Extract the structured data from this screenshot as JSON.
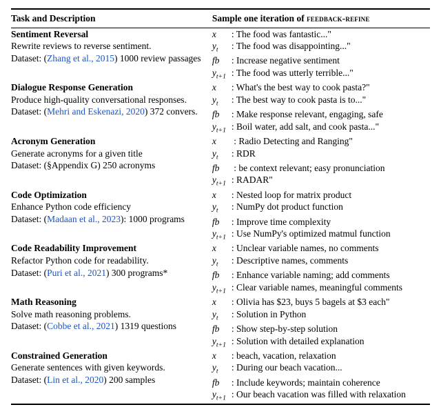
{
  "header": {
    "left": "Task and Description",
    "right_prefix": "Sample one iteration of ",
    "right_method": "feedback-refine"
  },
  "rows": [
    {
      "title": "Sentiment Reversal",
      "desc": "Rewrite reviews to reverse sentiment.",
      "ds_prefix": "Dataset: (",
      "ds_cite": "Zhang et al., 2015",
      "ds_suffix": ") 1000 review passages",
      "x": "The food was fantastic...\"",
      "yt": "The food was disappointing...\"",
      "fb": "Increase negative sentiment",
      "yt1": "The food was utterly terrible...\""
    },
    {
      "title": "Dialogue Response Generation",
      "desc": "Produce high-quality conversational responses.",
      "ds_prefix": "Dataset: (",
      "ds_cite": "Mehri and Eskenazi, 2020",
      "ds_suffix": ") 372 convers.",
      "x": "What's the best way to cook pasta?\"",
      "yt": "The best way to cook pasta is to...\"",
      "fb": "Make response relevant, engaging, safe",
      "yt1": "Boil water, add salt, and cook pasta...\""
    },
    {
      "title": "Acronym Generation",
      "desc": "Generate acronyms for a given title",
      "ds_prefix": "Dataset: (",
      "ds_cite": "§Appendix G",
      "ds_cite_plain": true,
      "ds_suffix": ") 250 acronyms",
      "x": "Radio Detecting and Ranging\"",
      "x_extra_colon": true,
      "yt": "RDR",
      "fb": "be context relevant; easy pronunciation",
      "fb_extra_colon": true,
      "yt1": "RADAR\""
    },
    {
      "title": "Code Optimization",
      "desc": "Enhance Python code efficiency",
      "ds_prefix": "Dataset: (",
      "ds_cite": "Madaan et al., 2023",
      "ds_suffix": "): 1000 programs",
      "x": "Nested loop for matrix product",
      "yt": "NumPy dot product function",
      "fb": "Improve time complexity",
      "yt1": "Use NumPy's optimized matmul function"
    },
    {
      "title": "Code Readability Improvement",
      "desc": "Refactor Python code for readability.",
      "ds_prefix": "Dataset: (",
      "ds_cite": "Puri et al., 2021",
      "ds_suffix": ") 300 programs*",
      "x": "Unclear variable names, no comments",
      "yt": "Descriptive names, comments",
      "fb": "Enhance variable naming; add comments",
      "yt1": "Clear variable names, meaningful comments"
    },
    {
      "title": "Math Reasoning",
      "desc": "Solve math reasoning problems.",
      "ds_prefix": "Dataset: (",
      "ds_cite": "Cobbe et al., 2021",
      "ds_suffix": ") 1319 questions",
      "x": "Olivia has $23, buys 5 bagels at $3 each\"",
      "yt": "Solution in Python",
      "fb": "Show step-by-step solution",
      "yt1": "Solution with detailed explanation"
    },
    {
      "title": "Constrained Generation",
      "desc": "Generate sentences with given keywords.",
      "ds_prefix": "Dataset: (",
      "ds_cite": "Lin et al., 2020",
      "ds_suffix": ") 200 samples",
      "x": "beach, vacation, relaxation",
      "yt": "During our beach vacation...",
      "fb": "Include keywords; maintain coherence",
      "yt1": "Our beach vacation was filled with relaxation"
    }
  ],
  "sym": {
    "x": "x",
    "yt": "y",
    "yt_sub": "t",
    "fb": "fb",
    "yt1": "y",
    "yt1_sub": "t+1"
  }
}
